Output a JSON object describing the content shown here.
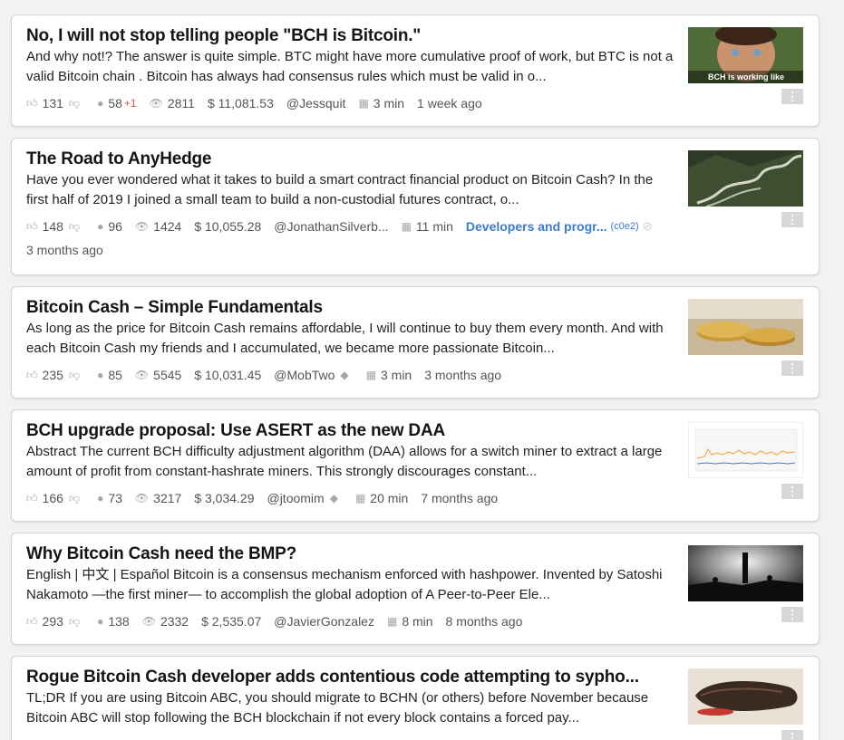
{
  "posts": [
    {
      "title": "No, I will not stop telling people \"BCH is Bitcoin.\"",
      "excerpt": "And why not!? The answer is quite simple. BTC might have more cumulative proof of work, but BTC is not a valid Bitcoin chain . Bitcoin has always had consensus rules which must be valid in o...",
      "likes": "131",
      "comments": "58",
      "comments_new": "+1",
      "views": "2811",
      "earnings": "$ 11,081.53",
      "author": "@Jessquit",
      "read_time": "3 min",
      "age": "1 week ago",
      "thumb_caption": "BCH is working like"
    },
    {
      "title": "The Road to AnyHedge",
      "excerpt": "Have you ever wondered what it takes to build a smart contract financial product on Bitcoin Cash? In the first half of 2019 I joined a small team to build a non-custodial futures contract, o...",
      "likes": "148",
      "comments": "96",
      "views": "1424",
      "earnings": "$ 10,055.28",
      "author": "@JonathanSilverb...",
      "read_time": "11 min",
      "topic": "Developers and progr...",
      "topic_code": "(c0e2)",
      "age": "3 months ago"
    },
    {
      "title": "Bitcoin Cash – Simple Fundamentals",
      "excerpt": "As long as the price for Bitcoin Cash remains affordable, I will continue to buy them every month. And with each Bitcoin Cash my friends and I accumulated, we became more passionate Bitcoin...",
      "likes": "235",
      "comments": "85",
      "views": "5545",
      "earnings": "$ 10,031.45",
      "author": "@MobTwo",
      "read_time": "3 min",
      "age": "3 months ago"
    },
    {
      "title": "BCH upgrade proposal: Use ASERT as the new DAA",
      "excerpt": "Abstract The current BCH difficulty adjustment algorithm (DAA) allows for a switch miner to extract a large amount of profit from constant-hashrate miners. This strongly discourages constant...",
      "likes": "166",
      "comments": "73",
      "views": "3217",
      "earnings": "$ 3,034.29",
      "author": "@jtoomim",
      "read_time": "20 min",
      "age": "7 months ago"
    },
    {
      "title": "Why Bitcoin Cash need the BMP?",
      "excerpt": "English | 中文 |  Español Bitcoin is a consensus mechanism enforced with hashpower. Invented by Satoshi Nakamoto —the first miner— to accomplish the global adoption of A Peer-to-Peer Ele...",
      "likes": "293",
      "comments": "138",
      "views": "2332",
      "earnings": "$ 2,535.07",
      "author": "@JavierGonzalez",
      "read_time": "8 min",
      "age": "8 months ago"
    },
    {
      "title": "Rogue Bitcoin Cash developer adds contentious code attempting to sypho...",
      "excerpt": "TL;DR If you are using Bitcoin ABC, you should migrate to BCHN (or others) before November because Bitcoin ABC will stop following the BCH blockchain if not every block contains a forced pay...",
      "likes": "",
      "comments": "",
      "views": "",
      "earnings": "",
      "author": "",
      "read_time": "",
      "age": ""
    }
  ],
  "icons": {
    "like": "thumbs-up-icon",
    "dislike": "thumbs-down-icon",
    "comments": "comment-bubble-icon",
    "views": "eye-icon",
    "read_time": "reader-icon",
    "menu": "more-vertical-icon",
    "diamond": "diamond-icon",
    "banned": "banned-icon"
  },
  "more_glyph": "⋮",
  "colors": {
    "accent": "#3a7bd5",
    "new_comment": "#d9534f",
    "icon_gray": "#a7a7a7"
  }
}
